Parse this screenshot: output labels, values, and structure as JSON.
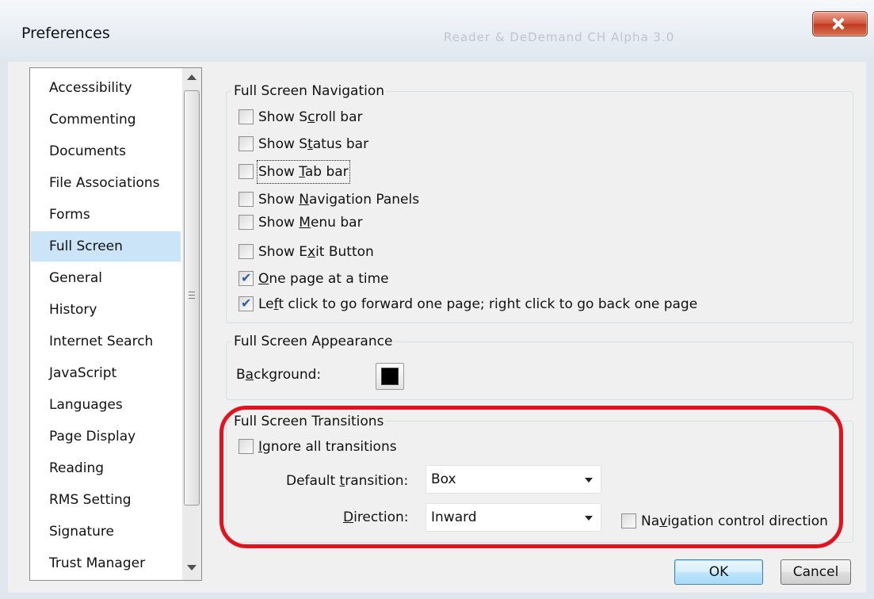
{
  "window": {
    "title": "Preferences",
    "ghost_title": "Reader & DeDemand CH Alpha 3.0"
  },
  "sidebar": {
    "items": [
      {
        "label": "Accessibility",
        "selected": false
      },
      {
        "label": "Commenting",
        "selected": false
      },
      {
        "label": "Documents",
        "selected": false
      },
      {
        "label": "File Associations",
        "selected": false
      },
      {
        "label": "Forms",
        "selected": false
      },
      {
        "label": "Full Screen",
        "selected": true
      },
      {
        "label": "General",
        "selected": false
      },
      {
        "label": "History",
        "selected": false
      },
      {
        "label": "Internet Search",
        "selected": false
      },
      {
        "label": "JavaScript",
        "selected": false
      },
      {
        "label": "Languages",
        "selected": false
      },
      {
        "label": "Page Display",
        "selected": false
      },
      {
        "label": "Reading",
        "selected": false
      },
      {
        "label": "RMS Setting",
        "selected": false
      },
      {
        "label": "Signature",
        "selected": false
      },
      {
        "label": "Trust Manager",
        "selected": false
      }
    ]
  },
  "navigation": {
    "legend": "Full Screen Navigation",
    "options": [
      {
        "pre": "Show S",
        "key": "c",
        "post": "roll bar",
        "checked": false
      },
      {
        "pre": "Show S",
        "key": "t",
        "post": "atus bar",
        "checked": false
      },
      {
        "pre": "Show ",
        "key": "T",
        "post": "ab bar",
        "checked": false
      },
      {
        "pre": "Show ",
        "key": "N",
        "post": "avigation Panels",
        "checked": false
      },
      {
        "pre": "Show ",
        "key": "M",
        "post": "enu bar",
        "checked": false
      },
      {
        "pre": "Show E",
        "key": "x",
        "post": "it Button",
        "checked": false
      },
      {
        "pre": "",
        "key": "O",
        "post": "ne page at a time",
        "checked": true
      },
      {
        "pre": "Le",
        "key": "f",
        "post": "t click to go forward one page; right click to go back one page",
        "checked": true
      }
    ]
  },
  "appearance": {
    "legend": "Full Screen Appearance",
    "background_label_pre": "B",
    "background_label_key": "a",
    "background_label_post": "ckground:",
    "background_color": "#000000"
  },
  "transitions": {
    "legend": "Full Screen Transitions",
    "ignore_pre": "",
    "ignore_key": "I",
    "ignore_post": "gnore all transitions",
    "ignore_checked": false,
    "default_label_pre": "Default ",
    "default_label_key": "t",
    "default_label_post": "ransition:",
    "default_value": "Box",
    "direction_label_pre": "",
    "direction_label_key": "D",
    "direction_label_post": "irection:",
    "direction_value": "Inward",
    "navctl_pre": "Na",
    "navctl_key": "v",
    "navctl_post": "igation control direction",
    "navctl_checked": false
  },
  "buttons": {
    "ok": "OK",
    "cancel": "Cancel"
  },
  "colors": {
    "highlight": "#e0141e",
    "selection": "#cce4f7"
  }
}
